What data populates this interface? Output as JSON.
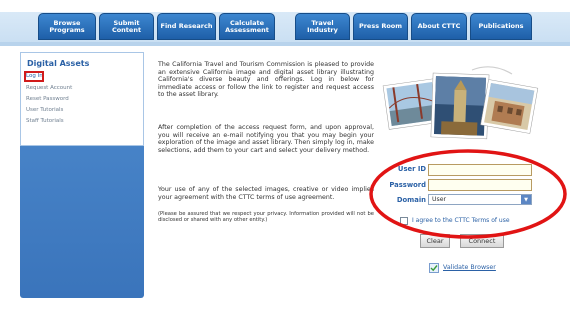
{
  "nav": {
    "tabs": [
      {
        "label": "Browse\nPrograms"
      },
      {
        "label": "Submit\nContent"
      },
      {
        "label": "Find Research"
      },
      {
        "label": "Calculate\nAssessment"
      },
      {
        "label": "Travel\nIndustry"
      },
      {
        "label": "Press Room"
      },
      {
        "label": "About CTTC"
      },
      {
        "label": "Publications"
      }
    ]
  },
  "sidebar": {
    "title": "Digital Assets",
    "items": [
      {
        "label": "Log In"
      },
      {
        "label": "Request Account"
      },
      {
        "label": "Reset Password"
      },
      {
        "label": "User Tutorials"
      },
      {
        "label": "Staff Tutorials"
      }
    ]
  },
  "main": {
    "paragraphs": [
      "The California Travel and Tourism Commission is pleased to provide an extensive California image and digital asset library illustrating California's diverse beauty and offerings. Log in below for immediate access or follow the link to register and request access to the asset library.",
      "After completion of the access request form, and upon approval, you will receive an e-mail notifying you that you may begin your exploration of the image and asset library. Then simply log in, make selections, add them to your cart and select your delivery method.",
      "Your use of any of the selected images, creative or video implies your agreement with the CTTC terms of use agreement.",
      "(Please be assured that we respect your privacy. Information provided will not be disclosed or shared with any other entity.)"
    ]
  },
  "login": {
    "user_id_label": "User ID",
    "user_id_value": "",
    "password_label": "Password",
    "password_value": "",
    "domain_label": "Domain",
    "domain_value": "User",
    "terms_label": "I agree to the CTTC Terms of use",
    "clear_label": "Clear",
    "connect_label": "Connect",
    "validate_label": "Validate Browser"
  },
  "colors": {
    "nav_tab": "#2a6cb8",
    "sidebar": "#3f7bc2",
    "link": "#2b61a6",
    "highlight": "#e11414"
  }
}
